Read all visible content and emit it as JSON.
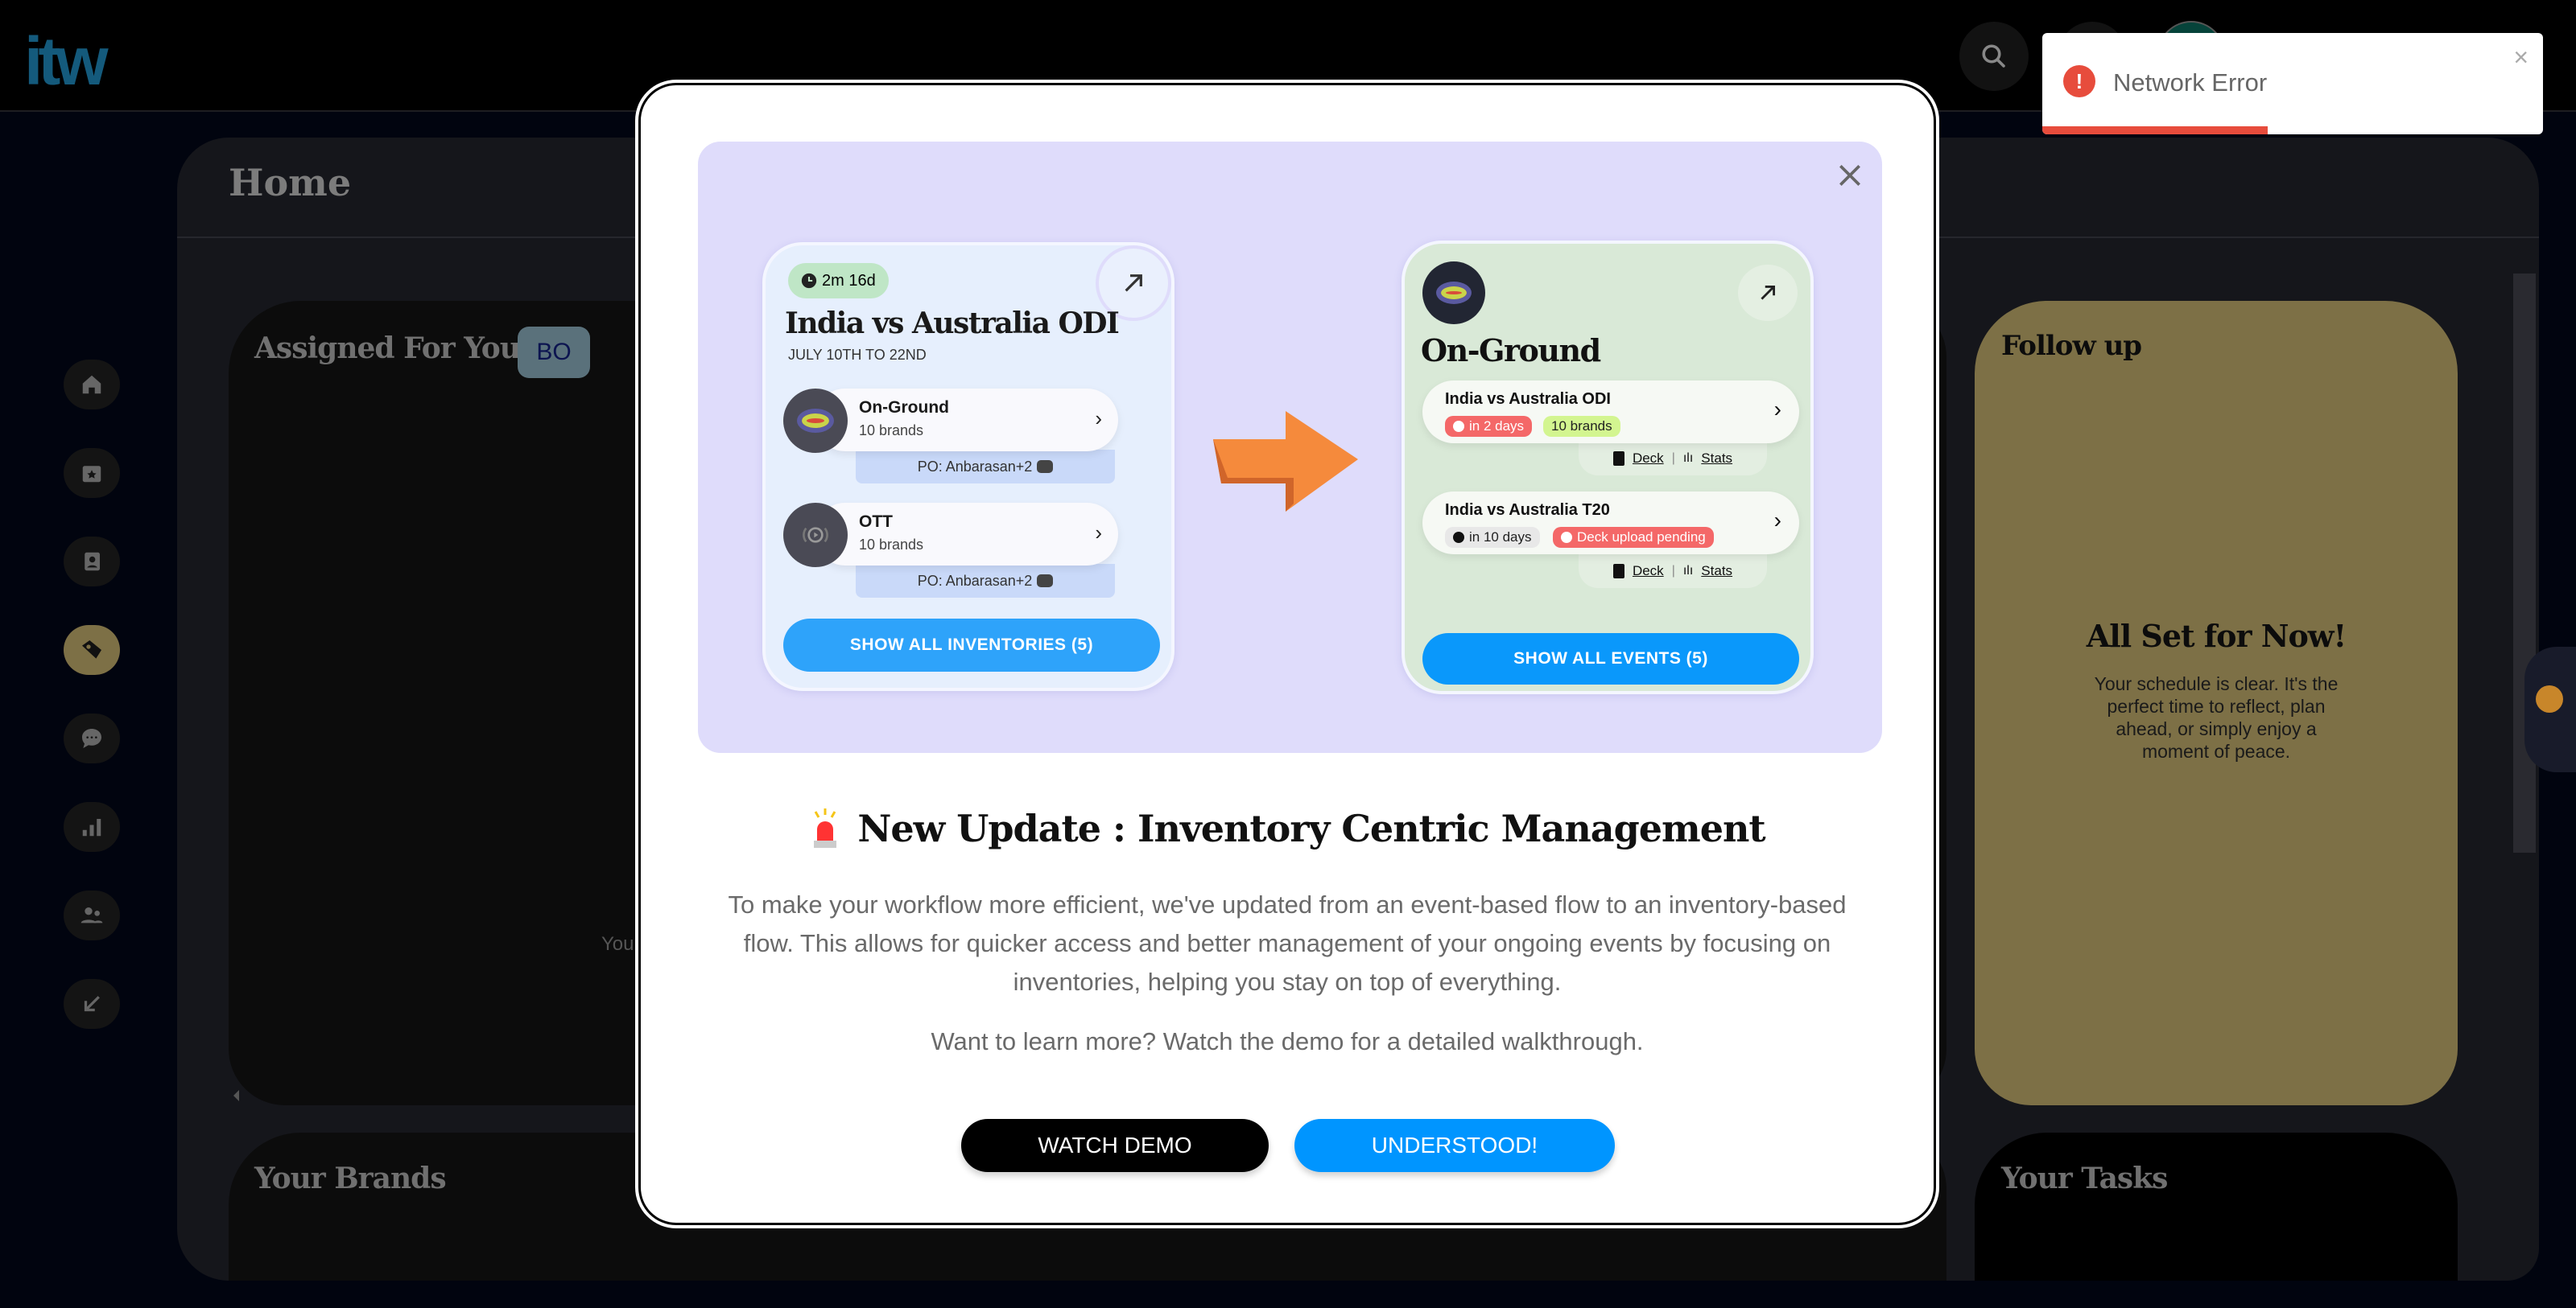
{
  "header": {
    "logo": "itw"
  },
  "toast": {
    "message": "Network Error",
    "progress_percent": 45,
    "color": "#e74c3c"
  },
  "sidebar": {
    "items": [
      {
        "icon": "home-icon"
      },
      {
        "icon": "calendar-star-icon"
      },
      {
        "icon": "contacts-icon"
      },
      {
        "icon": "tag-icon",
        "active": true
      },
      {
        "icon": "chat-icon"
      },
      {
        "icon": "bar-chart-icon"
      },
      {
        "icon": "users-icon"
      },
      {
        "icon": "arrow-down-left-icon"
      }
    ]
  },
  "page": {
    "title": "Home",
    "assigned": {
      "title": "Assigned For You",
      "badge": "BO",
      "partial_text": "Your"
    },
    "follow_up": {
      "title": "Follow up",
      "empty_title": "All Set for Now!",
      "empty_text": "Your schedule is clear. It's the perfect time to reflect, plan ahead, or simply enjoy a moment of peace.",
      "color": "#7d7046"
    },
    "brands": {
      "title": "Your Brands"
    },
    "tasks": {
      "title": "Your Tasks"
    }
  },
  "modal": {
    "before_card": {
      "timer": "2m 16d",
      "title": "India vs Australia ODI",
      "dates": "JULY 10TH TO 22ND",
      "inventories": [
        {
          "name": "On-Ground",
          "brands": "10 brands",
          "po": "PO: Anbarasan+2"
        },
        {
          "name": "OTT",
          "brands": "10 brands",
          "po": "PO: Anbarasan+2"
        }
      ],
      "button": "SHOW ALL INVENTORIES (5)"
    },
    "after_card": {
      "title": "On-Ground",
      "events": [
        {
          "name": "India vs Australia ODI",
          "when": "in 2 days",
          "tag": "10 brands",
          "deck": "Deck",
          "stats": "Stats"
        },
        {
          "name": "India vs Australia T20",
          "when": "in 10 days",
          "tag": "Deck upload pending",
          "deck": "Deck",
          "stats": "Stats"
        }
      ],
      "button": "SHOW ALL EVENTS (5)"
    },
    "title": "New Update : Inventory Centric Management",
    "paragraph": "To make your workflow more efficient, we've updated from an event-based flow to an inventory-based flow. This allows for quicker access and better management of your ongoing events by focusing on inventories, helping you stay on top of everything.",
    "paragraph2": "Want to learn more? Watch the demo for a detailed walkthrough.",
    "watch_demo": "WATCH DEMO",
    "understood": "UNDERSTOOD!",
    "accent": "#0095ff"
  }
}
